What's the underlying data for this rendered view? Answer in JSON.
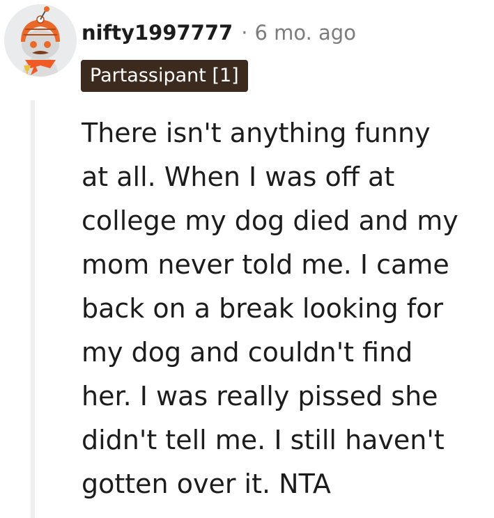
{
  "comment": {
    "author": "nifty1997777",
    "separator": "·",
    "timestamp": "6 mo. ago",
    "flair": "Partassipant [1]",
    "body": "There isn't anything funny\nat all. When I was off at\ncollege my dog died and my\nmom never told me. I came\nback on a break looking for\nmy dog and couldn't find\nher. I was really pissed she\ndidn't tell me. I still haven't\ngotten over it. NTA"
  },
  "avatar": {
    "icon": "snoo-avatar-icon",
    "colors": {
      "background": "#e9ebed",
      "helmet": "#e8692a",
      "face": "#d8d8d8",
      "scarf": "#f05a24"
    }
  },
  "colors": {
    "flair_background": "#3c2a1f",
    "flair_text": "#ffffff",
    "meta_text": "#7c7c7c",
    "thread_line": "#edeff1"
  }
}
